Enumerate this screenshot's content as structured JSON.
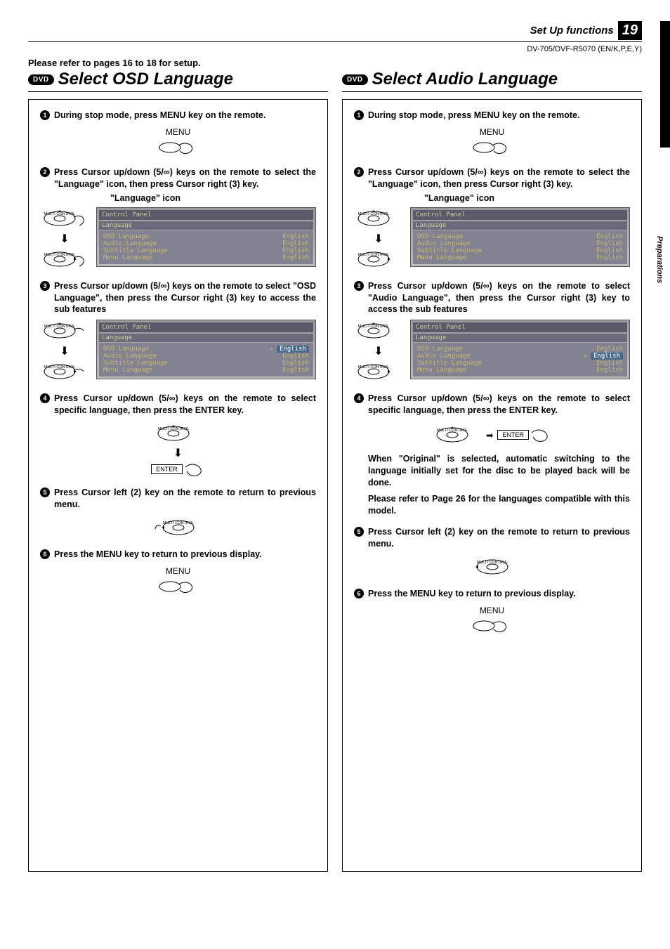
{
  "header": {
    "section": "Set Up functions",
    "page_number": "19",
    "model_code": "DV-705/DVF-R5070 (EN/K,P,E,Y)",
    "side_tab": "Preparations"
  },
  "setup_reference": "Please refer to pages 16 to 18 for setup.",
  "dvd_badge": "DVD",
  "left": {
    "title": "Select OSD Language",
    "steps": {
      "s1": "During stop mode, press MENU key on the remote.",
      "menu_label": "MENU",
      "s2": "Press Cursor up/down (5/∞) keys on the remote to select the \"Language\" icon, then press Cursor right (3) key.",
      "lang_icon_label": "\"Language\" icon",
      "s3": "Press Cursor up/down (5/∞) keys on the remote to select \"OSD Language\", then press the Cursor right (3) key to access the sub features",
      "s4": "Press Cursor up/down (5/∞) keys on the remote to select specific language, then press the ENTER key.",
      "enter_label": "ENTER",
      "s5": "Press Cursor left (2) key on the remote to return to previous menu.",
      "s6": "Press the MENU key to return to previous display."
    }
  },
  "right": {
    "title": "Select Audio Language",
    "steps": {
      "s1": "During stop mode, press MENU key on the remote.",
      "menu_label": "MENU",
      "s2": "Press Cursor up/down (5/∞) keys on the remote to select the \"Language\" icon, then press Cursor right (3) key.",
      "lang_icon_label": "\"Language\" icon",
      "s3": "Press Cursor up/down (5/∞) keys on the remote to select \"Audio Language\", then press the Cursor right (3) key to access the sub features",
      "s4": "Press Cursor up/down (5/∞) keys on the remote to select specific language, then press the ENTER key.",
      "enter_label": "ENTER",
      "note1": "When \"Original\" is selected, automatic switching to the language initially set for the disc to be played back will be done.",
      "note2": "Please refer to Page 26 for the languages compatible with this model.",
      "s5": "Press Cursor left (2) key on the remote to return to previous menu.",
      "s6": "Press the MENU key to return to previous display."
    }
  },
  "osd": {
    "panel_title": "Control Panel",
    "section": "Language",
    "rows": [
      {
        "label": "OSD Language",
        "value": "English"
      },
      {
        "label": "Audio Language",
        "value": "English"
      },
      {
        "label": "Subtitle Language",
        "value": "English"
      },
      {
        "label": "Menu Language",
        "value": "English"
      }
    ]
  },
  "remote": {
    "multi_control": "MULTI CONTROL"
  }
}
